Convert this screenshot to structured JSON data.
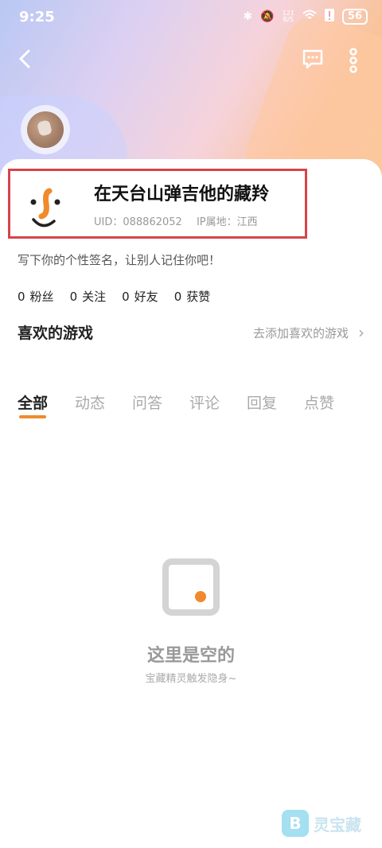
{
  "status_bar": {
    "time": "9:25",
    "net_speed_top": "121",
    "net_speed_bottom": "B/S",
    "battery": "56"
  },
  "profile": {
    "username": "在天台山弹吉他的藏羚",
    "uid": "UID：088862052",
    "ip_location": "IP属地：江西",
    "bio": "写下你的个性签名，让别人记住你吧！"
  },
  "stats": [
    {
      "count": "0",
      "label": "粉丝"
    },
    {
      "count": "0",
      "label": "关注"
    },
    {
      "count": "0",
      "label": "好友"
    },
    {
      "count": "0",
      "label": "获赞"
    }
  ],
  "games": {
    "title": "喜欢的游戏",
    "link": "去添加喜欢的游戏"
  },
  "tabs": [
    {
      "label": "全部",
      "active": true
    },
    {
      "label": "动态"
    },
    {
      "label": "问答"
    },
    {
      "label": "评论"
    },
    {
      "label": "回复"
    },
    {
      "label": "点赞"
    }
  ],
  "empty": {
    "title": "这里是空的",
    "subtitle": "宝藏精灵触发隐身~"
  },
  "watermark": {
    "text": "灵宝藏"
  },
  "colors": {
    "accent": "#f08a2c",
    "highlight_border": "#d7444a"
  }
}
